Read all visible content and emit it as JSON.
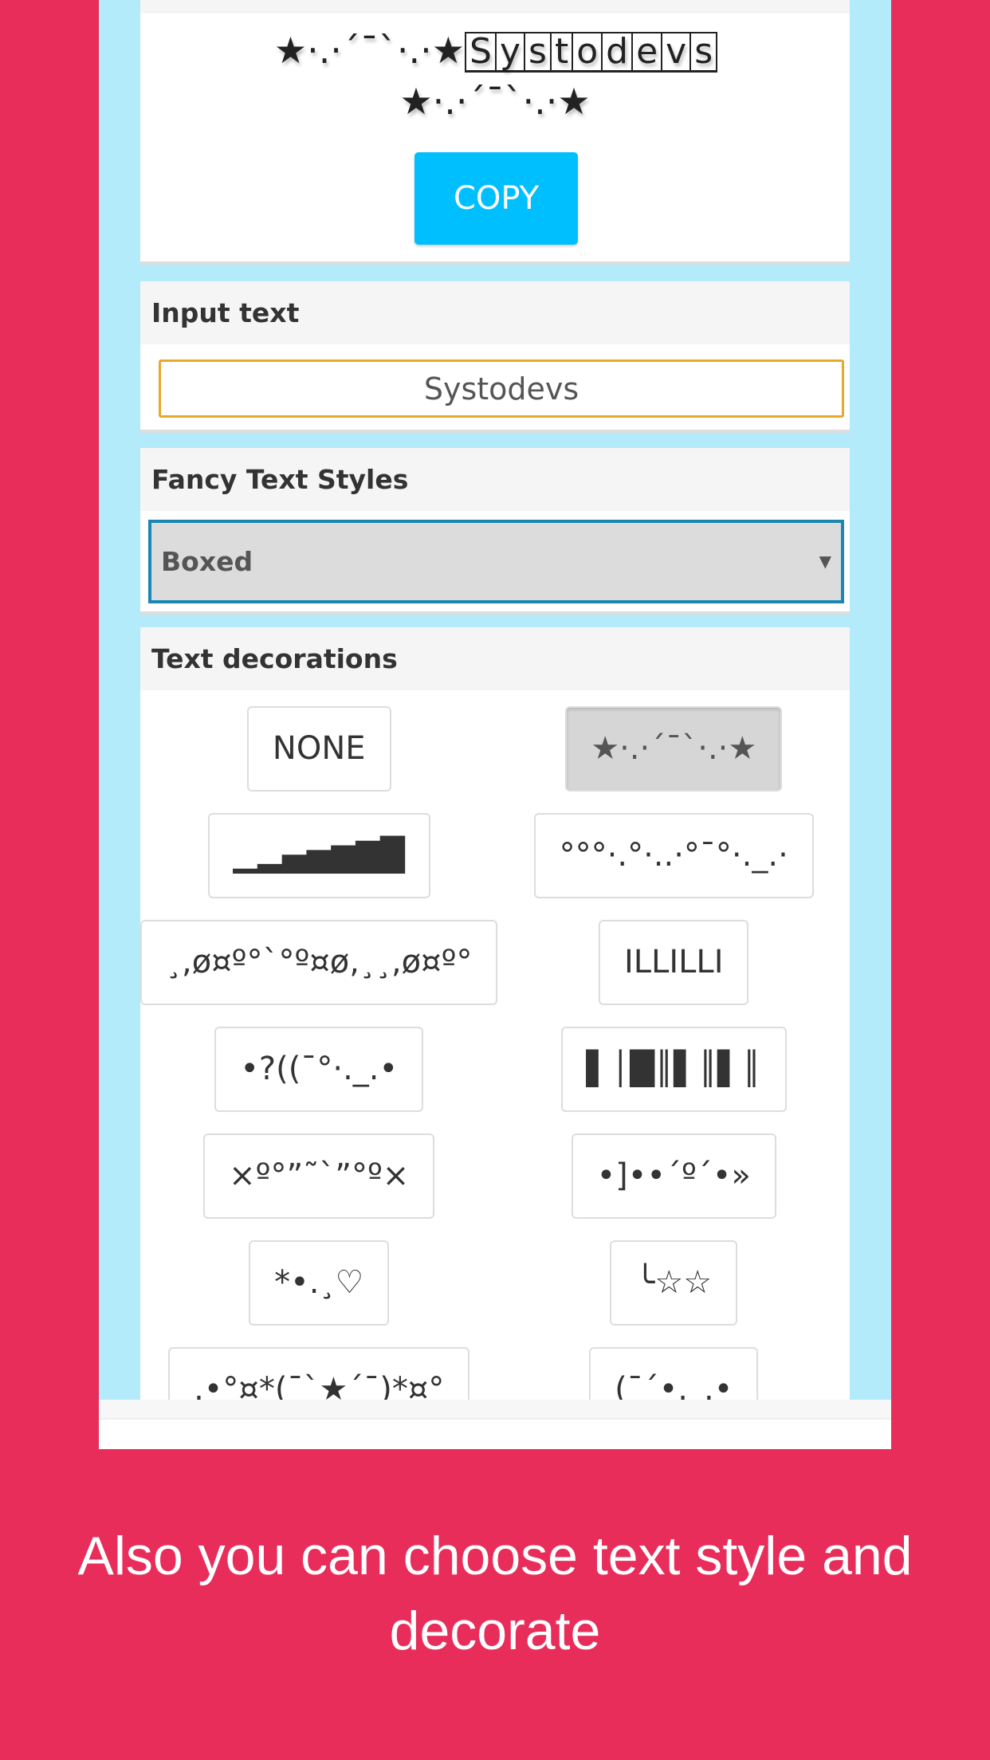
{
  "output": {
    "prefix": "★·.·´¯`·.·★",
    "letters": [
      "S",
      "y",
      "s",
      "t",
      "o",
      "d",
      "e",
      "v",
      "s"
    ],
    "suffix": "★·.·´¯`·.·★",
    "copy_label": "COPY"
  },
  "input": {
    "label": "Input text",
    "value": "Systodevs"
  },
  "styles": {
    "label": "Fancy Text Styles",
    "selected": "Boxed"
  },
  "decorations": {
    "label": "Text decorations",
    "selected_index": 1,
    "items": [
      "NONE",
      "★·.·´¯`·.·★",
      "▁▂▄▅▆▇█",
      "°°°·.°·..·°¯°·._.·",
      "¸,ø¤º°`°º¤ø,¸¸,ø¤º°",
      "ILLILLI",
      "•?((¯°·._.•",
      "▌│█║▌║▌║",
      "×º°”˜`”°º×",
      "•]••´º´•»",
      "*•.¸♡",
      "╰☆☆",
      ".•°¤*(¯`★´¯)*¤°",
      "(¯´•._.•"
    ]
  },
  "caption": "Also you can choose text style and decorate",
  "colors": {
    "background": "#e82d5b",
    "screen": "#b3ebfb",
    "copy_button": "#00bfff",
    "input_border": "#e8a82a",
    "select_border": "#1a86b4"
  }
}
